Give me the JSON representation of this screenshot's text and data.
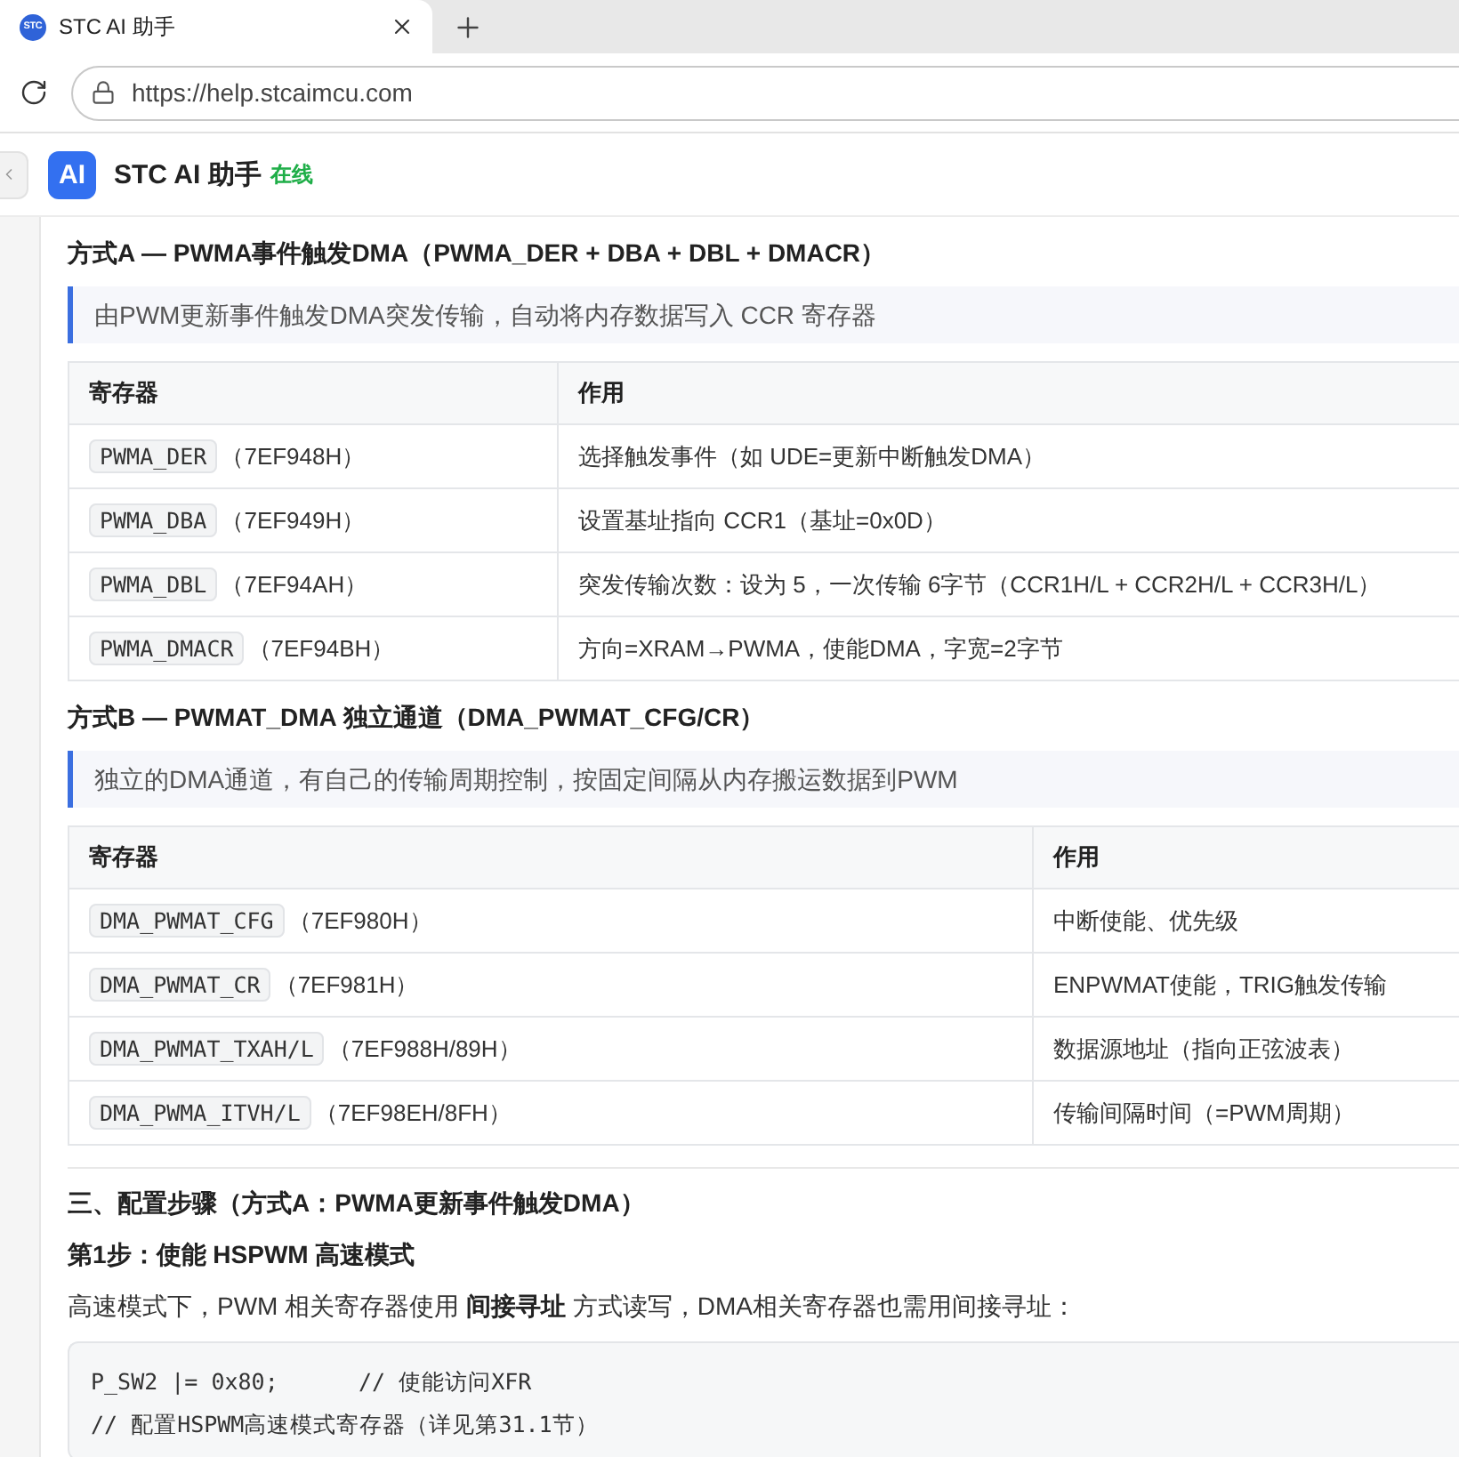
{
  "browser": {
    "tab": {
      "favicon_text": "STC",
      "title": "STC AI 助手",
      "selected": true
    },
    "address": "https://help.stcaimcu.com"
  },
  "app_header": {
    "logo": "AI",
    "title": "STC AI 助手",
    "status": "在线"
  },
  "content": [
    {
      "kind": "heading",
      "text": "方式A — PWMA事件触发DMA（PWMA_DER + DBA + DBL + DMACR）"
    },
    {
      "kind": "note",
      "text": "由PWM更新事件触发DMA突发传输，自动将内存数据写入 CCR 寄存器"
    },
    {
      "kind": "table",
      "columns": [
        "寄存器",
        "作用"
      ],
      "rows": [
        {
          "register": "PWMA_DER",
          "address": "（7EF948H）",
          "purpose": "选择触发事件（如 UDE=更新中断触发DMA）"
        },
        {
          "register": "PWMA_DBA",
          "address": "（7EF949H）",
          "purpose": "设置基址指向 CCR1（基址=0x0D）"
        },
        {
          "register": "PWMA_DBL",
          "address": "（7EF94AH）",
          "purpose": "突发传输次数：设为 5，一次传输 6字节（CCR1H/L + CCR2H/L + CCR3H/L）"
        },
        {
          "register": "PWMA_DMACR",
          "address": "（7EF94BH）",
          "purpose": "方向=XRAM→PWMA，使能DMA，字宽=2字节"
        }
      ]
    },
    {
      "kind": "heading",
      "text": "方式B — PWMAT_DMA 独立通道（DMA_PWMAT_CFG/CR）"
    },
    {
      "kind": "note",
      "text": "独立的DMA通道，有自己的传输周期控制，按固定间隔从内存搬运数据到PWM"
    },
    {
      "kind": "table",
      "columns": [
        "寄存器",
        "作用"
      ],
      "rows": [
        {
          "register": "DMA_PWMAT_CFG",
          "address": "（7EF980H）",
          "purpose": "中断使能、优先级"
        },
        {
          "register": "DMA_PWMAT_CR",
          "address": "（7EF981H）",
          "purpose": "ENPWMAT使能，TRIG触发传输"
        },
        {
          "register": "DMA_PWMAT_TXAH/L",
          "address": "（7EF988H/89H）",
          "purpose": "数据源地址（指向正弦波表）"
        },
        {
          "register": "DMA_PWMA_ITVH/L",
          "address": "（7EF98EH/8FH）",
          "purpose": "传输间隔时间（=PWM周期）"
        }
      ]
    },
    {
      "kind": "rule"
    },
    {
      "kind": "heading",
      "text": "三、配置步骤（方式A：PWMA更新事件触发DMA）"
    },
    {
      "kind": "heading",
      "text": "第1步：使能 HSPWM 高速模式"
    },
    {
      "kind": "paragraph",
      "text": "高速模式下，PWM 相关寄存器使用 **间接寻址** 方式读写，DMA相关寄存器也需用间接寻址："
    },
    {
      "kind": "code",
      "lines": [
        "P_SW2 |= 0x80;      // 使能访问XFR",
        "// 配置HSPWM高速模式寄存器（详见第31.1节）"
      ]
    }
  ]
}
